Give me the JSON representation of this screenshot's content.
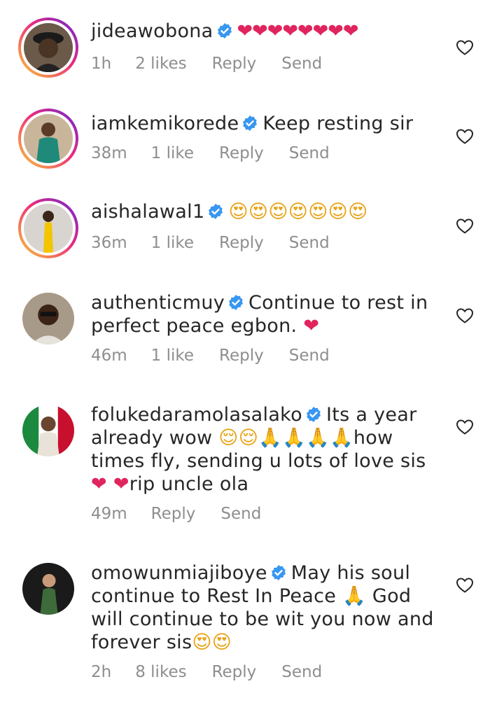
{
  "comments": [
    {
      "username": "jideawobona",
      "text": "",
      "emojis": "❤❤❤❤❤❤❤❤",
      "time": "1h",
      "likes": "2 likes",
      "reply": "Reply",
      "send": "Send"
    },
    {
      "username": "iamkemikorede",
      "text": "Keep resting sir",
      "time": "38m",
      "likes": "1 like",
      "reply": "Reply",
      "send": "Send"
    },
    {
      "username": "aishalawal1",
      "emojis": "😍😍😍😍😍😍😍",
      "time": "36m",
      "likes": "1 like",
      "reply": "Reply",
      "send": "Send"
    },
    {
      "username": "authenticmuy",
      "text": "Continue to rest in perfect peace egbon.",
      "emoji_end": "❤",
      "time": "46m",
      "likes": "1 like",
      "reply": "Reply",
      "send": "Send"
    },
    {
      "username": "folukedaramolasalako",
      "text_a": "Its a year already wow",
      "emoji_a": "😌😌🙏🙏🙏🙏",
      "text_b": "how times fly, sending u lots of love sis",
      "emoji_b": "❤",
      "emoji_c": "❤",
      "text_c": "rip uncle ola",
      "time": "49m",
      "reply": "Reply",
      "send": "Send"
    },
    {
      "username": "omowunmiajiboye",
      "text_a": "May his soul continue to Rest In Peace",
      "emoji_a": "🙏",
      "text_b": "God will continue to be wit you now and forever sis",
      "emoji_b": "😍😍",
      "time": "2h",
      "likes": "8 likes",
      "reply": "Reply",
      "send": "Send"
    }
  ],
  "colors": {
    "text": "#262626",
    "meta": "#8e8e8e",
    "verified": "#3897f0",
    "heart": "#e0245e"
  },
  "icons": {
    "verified": "verified-badge-icon",
    "like": "heart-outline-icon"
  }
}
